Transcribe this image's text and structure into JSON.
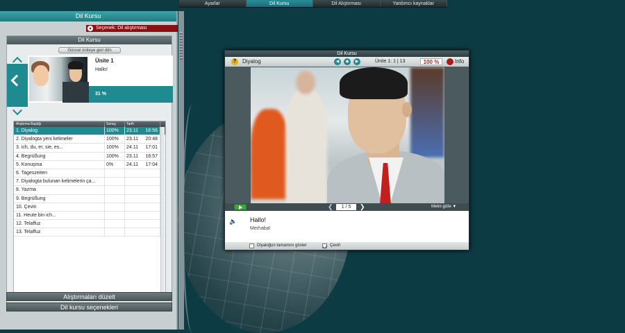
{
  "nav": {
    "tabs": [
      "Ayarlar",
      "Dil Kursu",
      "Dil Alıştırması",
      "Yardımcı kaynaklar"
    ],
    "active": 1
  },
  "left": {
    "title": "Dil Kursu",
    "option_label": "Seçenek: Dil alıştırması",
    "inner_title": "Dil Kursu",
    "back_button": "Güncel üniteye geri dön",
    "unit": {
      "title": "Ünite 1",
      "subtitle": "Hallo!",
      "progress": "31 %"
    },
    "table": {
      "headers": [
        "Alıştırma Başlığı",
        "Sonuç",
        "Tarih"
      ],
      "rows": [
        {
          "title": "1. Diyalog",
          "result": "100%",
          "date": "23.11",
          "time": "16:56"
        },
        {
          "title": "2. Diyalogta yeni kelimeler",
          "result": "100%",
          "date": "23.11",
          "time": "20:48"
        },
        {
          "title": "3. ich, du, er, sie, es...",
          "result": "100%",
          "date": "24.11",
          "time": "17:01"
        },
        {
          "title": "4. Begrüßung",
          "result": "100%",
          "date": "23.11",
          "time": "16:57"
        },
        {
          "title": "5. Konuşma",
          "result": "0%",
          "date": "24.11",
          "time": "17:04"
        },
        {
          "title": "6. Tageszeiten",
          "result": "",
          "date": "",
          "time": ""
        },
        {
          "title": "7. Diyalogta bulunan kelimelerin ça...",
          "result": "",
          "date": "",
          "time": ""
        },
        {
          "title": "8. Yazma",
          "result": "",
          "date": "",
          "time": ""
        },
        {
          "title": "9. Begrüßung",
          "result": "",
          "date": "",
          "time": ""
        },
        {
          "title": "10. Çeviri",
          "result": "",
          "date": "",
          "time": ""
        },
        {
          "title": "11. Heute bin ich...",
          "result": "",
          "date": "",
          "time": ""
        },
        {
          "title": "12. Telaffuz",
          "result": "",
          "date": "",
          "time": ""
        },
        {
          "title": "13. Telaffuz",
          "result": "",
          "date": "",
          "time": ""
        }
      ]
    },
    "edit_button": "Alıştırmaları düzelt",
    "options_button": "Dil kursu seçenekleri"
  },
  "dialog": {
    "window_title": "Dil Kursu",
    "label": "Diyalog",
    "help": "?",
    "unit_label": "Ünite 1:",
    "unit_count": "1 | 13",
    "percent": "100 %",
    "info": "Info",
    "page": "1 / 5",
    "hide_text": "Metni gizle",
    "text_de": "Hallo!",
    "text_tr": "Merhaba!",
    "show_full": "Diyaloğun tamamını göster",
    "translation": "Çeviri"
  },
  "colors": {
    "accent": "#1f8a90",
    "alert": "#8b0f12",
    "bg": "#0d3b44"
  }
}
